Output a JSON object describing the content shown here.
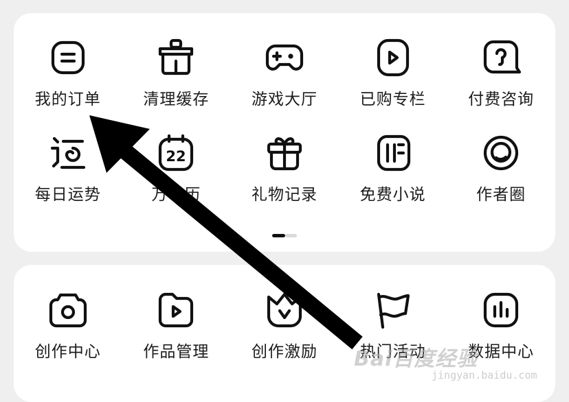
{
  "top_grid": {
    "row1": [
      {
        "label": "我的订单",
        "icon": "order-icon"
      },
      {
        "label": "清理缓存",
        "icon": "clear-cache-icon"
      },
      {
        "label": "游戏大厅",
        "icon": "gamepad-icon"
      },
      {
        "label": "已购专栏",
        "icon": "purchased-column-icon"
      },
      {
        "label": "付费咨询",
        "icon": "paid-consult-icon"
      }
    ],
    "row2": [
      {
        "label": "每日运势",
        "icon": "daily-fortune-icon"
      },
      {
        "label": "万年历",
        "icon": "calendar-icon",
        "icon_text": "22"
      },
      {
        "label": "礼物记录",
        "icon": "gift-icon"
      },
      {
        "label": "免费小说",
        "icon": "book-icon"
      },
      {
        "label": "作者圈",
        "icon": "author-circle-icon"
      }
    ]
  },
  "pager": {
    "current": 1,
    "total": 2
  },
  "bottom_grid": [
    {
      "label": "创作中心",
      "icon": "camera-icon"
    },
    {
      "label": "作品管理",
      "icon": "video-folder-icon"
    },
    {
      "label": "创作激励",
      "icon": "crown-icon"
    },
    {
      "label": "热门活动",
      "icon": "flag-icon"
    },
    {
      "label": "数据中心",
      "icon": "bar-chart-icon"
    }
  ],
  "watermark": {
    "text": "Bai百度经验",
    "url": "jingyan.baidu.com"
  },
  "colors": {
    "background": "#efefef",
    "card": "#ffffff",
    "text": "#1c1c1c",
    "arrow": "#000000"
  }
}
